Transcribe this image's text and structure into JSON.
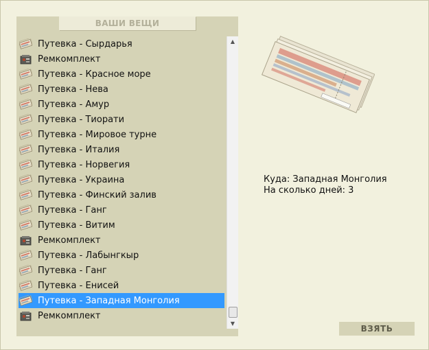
{
  "inventory": {
    "header": "ВАШИ ВЕЩИ",
    "items": [
      {
        "label": "Путевка - Сырдарья",
        "icon": "ticket-icon"
      },
      {
        "label": "Ремкомплект",
        "icon": "repair-kit-icon"
      },
      {
        "label": "Путевка - Красное море",
        "icon": "ticket-icon"
      },
      {
        "label": "Путевка - Нева",
        "icon": "ticket-icon"
      },
      {
        "label": "Путевка - Амур",
        "icon": "ticket-icon"
      },
      {
        "label": "Путевка - Тиорати",
        "icon": "ticket-icon"
      },
      {
        "label": "Путевка - Мировое турне",
        "icon": "ticket-icon"
      },
      {
        "label": "Путевка - Италия",
        "icon": "ticket-icon"
      },
      {
        "label": "Путевка - Норвегия",
        "icon": "ticket-icon"
      },
      {
        "label": "Путевка - Украина",
        "icon": "ticket-icon"
      },
      {
        "label": "Путевка - Финский залив",
        "icon": "ticket-icon"
      },
      {
        "label": "Путевка - Ганг",
        "icon": "ticket-icon"
      },
      {
        "label": "Путевка - Витим",
        "icon": "ticket-icon"
      },
      {
        "label": "Ремкомплект",
        "icon": "repair-kit-icon"
      },
      {
        "label": "Путевка - Лабынгкыр",
        "icon": "ticket-icon"
      },
      {
        "label": "Путевка - Ганг",
        "icon": "ticket-icon"
      },
      {
        "label": "Путевка - Енисей",
        "icon": "ticket-icon"
      },
      {
        "label": "Путевка - Западная Монголия",
        "icon": "ticket-icon",
        "selected": true
      },
      {
        "label": "Ремкомплект",
        "icon": "repair-kit-icon"
      }
    ]
  },
  "detail": {
    "image": "travel-tickets-image",
    "destination_line": "Куда: Западная Монголия",
    "days_line": "На сколько дней: 3"
  },
  "take_button": "ВЗЯТЬ",
  "colors": {
    "background": "#f2f1de",
    "panel": "#d5d3b6",
    "selection": "#3399ff"
  }
}
